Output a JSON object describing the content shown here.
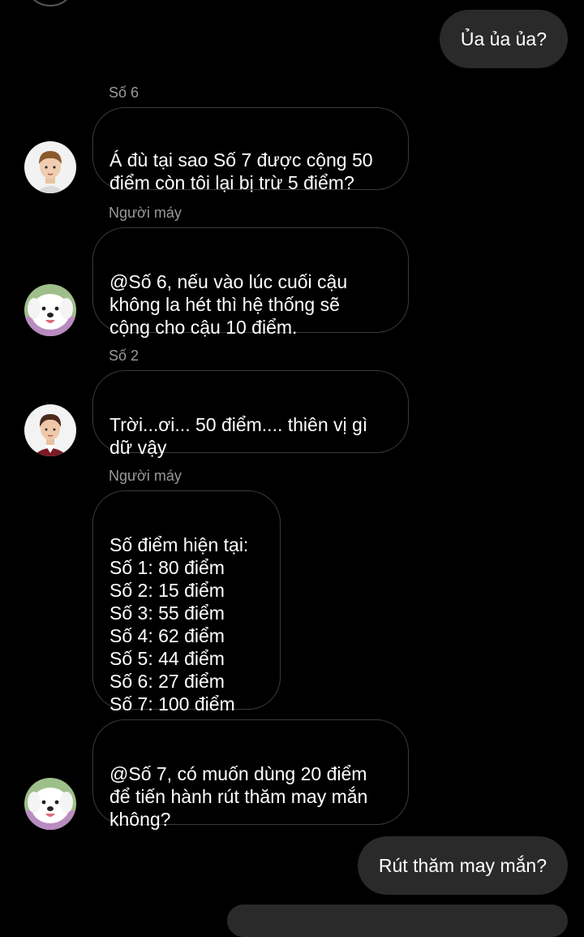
{
  "messages": {
    "m1": {
      "text": "Ủa ủa ủa?"
    },
    "m2": {
      "sender": "Số 6",
      "text": "Á đù tại sao Số 7 được cộng 50\nđiểm còn tôi lại bị trừ 5 điểm?",
      "avatar": "boy-avatar"
    },
    "m3": {
      "sender": "Người máy",
      "text": "@Số 6, nếu vào lúc cuối cậu\nkhông la hét thì hệ thống sẽ\ncộng cho cậu 10 điểm.",
      "avatar": "dog-avatar"
    },
    "m4": {
      "sender": "Số 2",
      "text": "Trời...ơi... 50 điểm.... thiên vị gì\ndữ vậy",
      "avatar": "man-avatar"
    },
    "m5": {
      "sender": "Người máy",
      "text": "Số điểm hiện tại:\nSố 1: 80 điểm\nSố 2: 15 điểm\nSố 3: 55 điểm\nSố 4: 62 điểm\nSố 5: 44 điểm\nSố 6: 27 điểm\nSố 7: 100 điểm"
    },
    "m6": {
      "text": "@Số 7, có muốn dùng 20 điểm\nđể tiến hành rút thăm may mắn\nkhông?",
      "avatar": "dog-avatar"
    },
    "m7": {
      "text": "Rút thăm may mắn?"
    }
  },
  "colors": {
    "background": "#000000",
    "outgoing_bubble": "#2a2a2a",
    "incoming_border": "#3a3a3a",
    "sender_name": "#9a9a9a"
  }
}
